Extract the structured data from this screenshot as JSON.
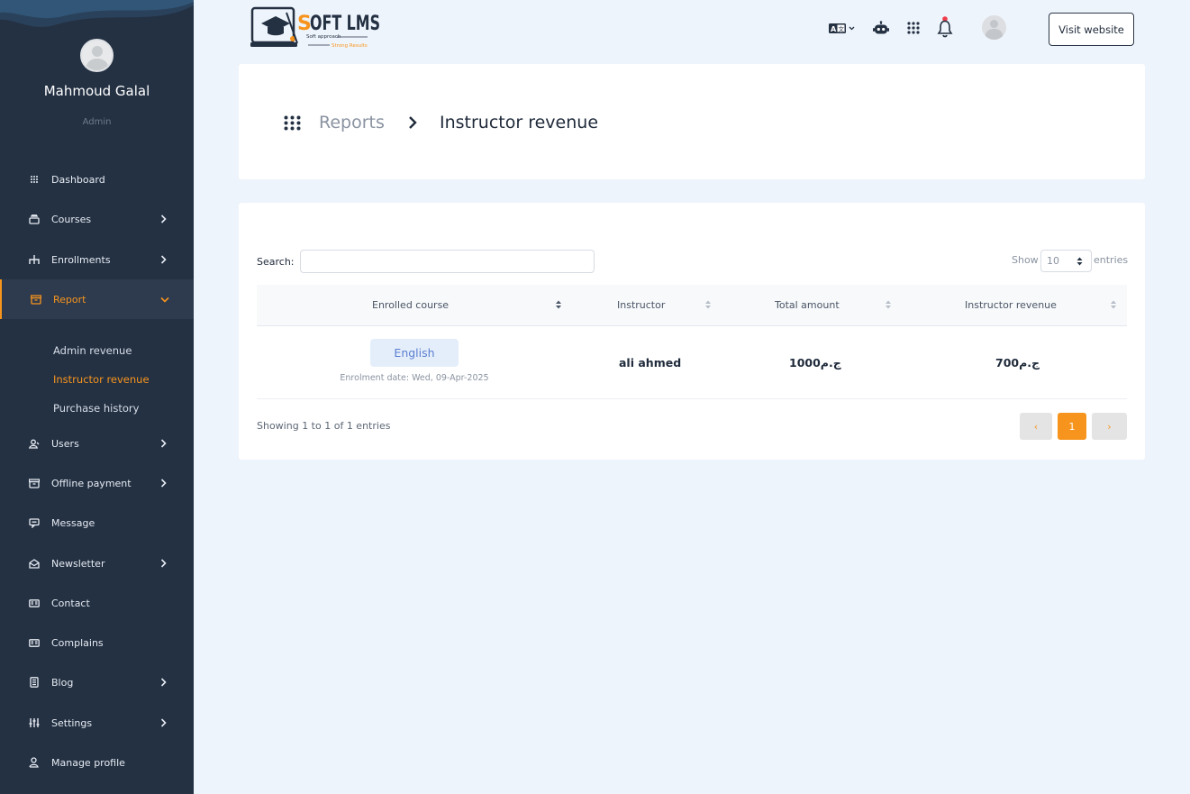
{
  "brand": {
    "name": "SOFT LMS",
    "tagline_1": "Soft approach",
    "tagline_2": "Strong Results",
    "accent": "#f7941d",
    "sidebar_bg": "#243143"
  },
  "user": {
    "name": "Mahmoud Galal",
    "role": "Admin"
  },
  "sidebar": {
    "items": [
      {
        "label": "Dashboard",
        "icon": "dashboard-icon"
      },
      {
        "label": "Courses",
        "icon": "courses-icon"
      },
      {
        "label": "Enrollments",
        "icon": "enrollments-icon"
      },
      {
        "label": "Report",
        "icon": "report-icon"
      },
      {
        "label": "Users",
        "icon": "users-icon"
      },
      {
        "label": "Offline payment",
        "icon": "offline-payment-icon"
      },
      {
        "label": "Message",
        "icon": "message-icon"
      },
      {
        "label": "Newsletter",
        "icon": "newsletter-icon"
      },
      {
        "label": "Contact",
        "icon": "contact-icon"
      },
      {
        "label": "Complains",
        "icon": "complains-icon"
      },
      {
        "label": "Blog",
        "icon": "blog-icon"
      },
      {
        "label": "Settings",
        "icon": "settings-icon"
      },
      {
        "label": "Manage profile",
        "icon": "profile-icon"
      }
    ],
    "report_sub": [
      {
        "label": "Admin revenue"
      },
      {
        "label": "Instructor revenue"
      },
      {
        "label": "Purchase history"
      }
    ]
  },
  "topbar": {
    "visit_label": "Visit website"
  },
  "breadcrumb": {
    "parent": "Reports",
    "current": "Instructor revenue"
  },
  "table": {
    "search_label": "Search:",
    "show_label": "Show",
    "show_value": "10",
    "entries_label": "entries",
    "headers": [
      "Enrolled course",
      "Instructor",
      "Total amount",
      "Instructor revenue"
    ],
    "rows": [
      {
        "course": "English",
        "enrolment_date": "Enrolment date: Wed, 09-Apr-2025",
        "instructor": "ali ahmed",
        "total": "1000ج.م",
        "revenue": "700ج.م"
      }
    ],
    "showing": "Showing 1 to 1 of 1 entries",
    "pagination": {
      "prev": "‹",
      "page": "1",
      "next": "›"
    }
  }
}
